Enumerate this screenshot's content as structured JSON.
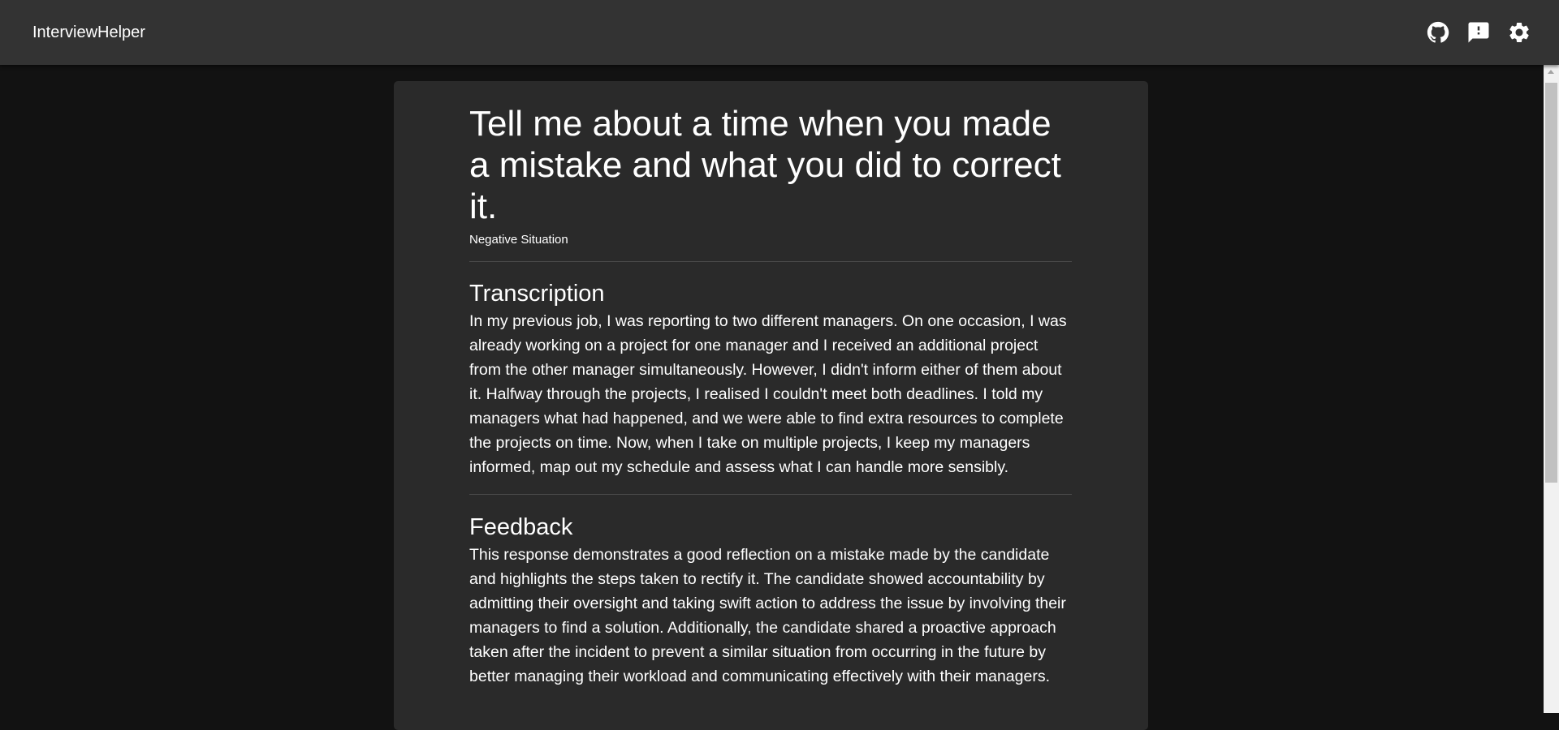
{
  "appbar": {
    "title": "InterviewHelper",
    "actions": [
      {
        "icon": "github-icon"
      },
      {
        "icon": "feedback-icon"
      },
      {
        "icon": "settings-icon"
      }
    ]
  },
  "question": {
    "text": "Tell me about a time when you made a mistake and what you did to correct it.",
    "category": "Negative Situation"
  },
  "transcription": {
    "title": "Transcription",
    "body": "In my previous job, I was reporting to two different managers. On one occasion, I was already working on a project for one manager and I received an additional project from the other manager simultaneously. However, I didn't inform either of them about it. Halfway through the projects, I realised I couldn't meet both deadlines. I told my managers what had happened, and we were able to find extra resources to complete the projects on time. Now, when I take on multiple projects, I keep my managers informed, map out my schedule and assess what I can handle more sensibly."
  },
  "feedback": {
    "title": "Feedback",
    "body": "This response demonstrates a good reflection on a mistake made by the candidate and highlights the steps taken to rectify it. The candidate showed accountability by admitting their oversight and taking swift action to address the issue by involving their managers to find a solution. Additionally, the candidate shared a proactive approach taken after the incident to prevent a similar situation from occurring in the future by better managing their workload and communicating effectively with their managers."
  },
  "colors": {
    "appbar": "#333333",
    "background": "#121212",
    "card": "#2a2a2a",
    "text": "#ffffff"
  }
}
